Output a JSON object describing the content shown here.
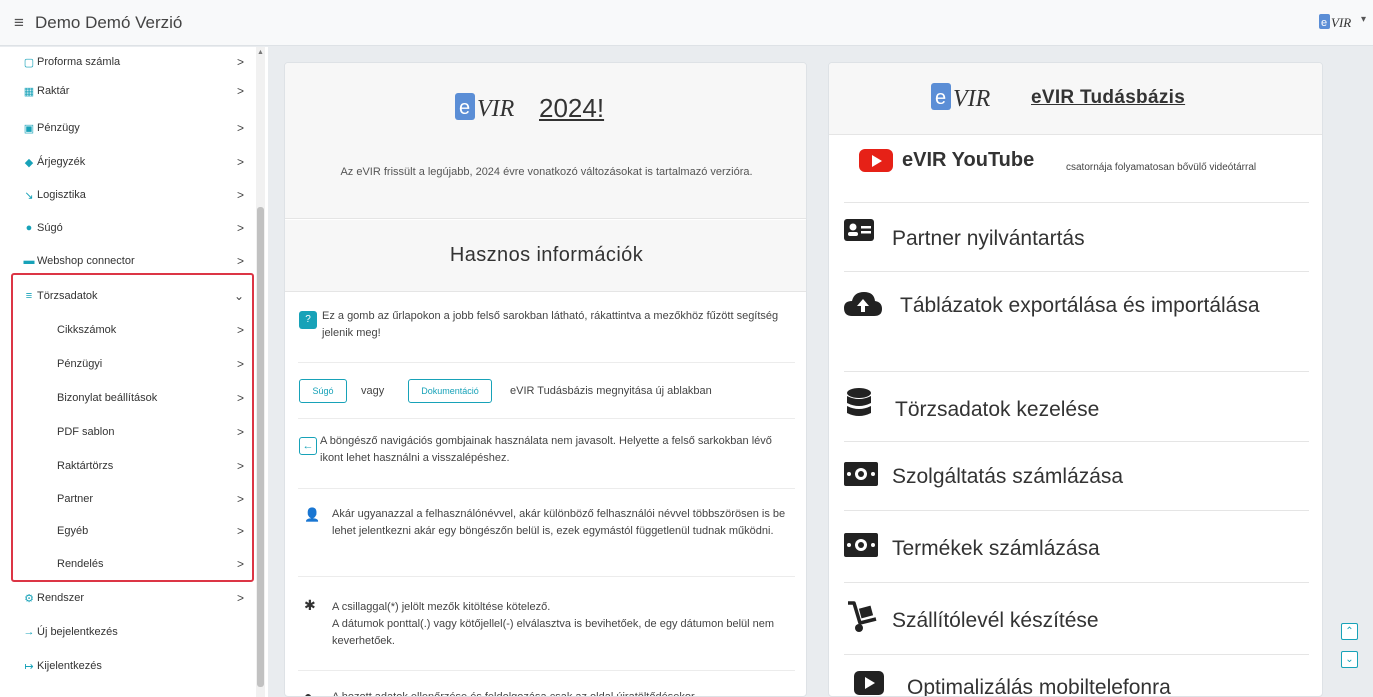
{
  "header": {
    "menu_icon": "hamburger-icon",
    "title": "Demo Demó Verzió",
    "user_caret": "▾"
  },
  "sidebar": {
    "items": [
      {
        "icon": "document-icon",
        "glyph": "▢",
        "label": "Proforma számla"
      },
      {
        "icon": "warehouse-icon",
        "glyph": "▦",
        "label": "Raktár"
      },
      {
        "icon": "money-icon",
        "glyph": "▣",
        "label": "Pénzügy"
      },
      {
        "icon": "tags-icon",
        "glyph": "◆",
        "label": "Árjegyzék"
      },
      {
        "icon": "dolly-icon",
        "glyph": "↘",
        "label": "Logisztika"
      },
      {
        "icon": "question-icon",
        "glyph": "●",
        "label": "Súgó"
      },
      {
        "icon": "cart-icon",
        "glyph": "▬",
        "label": "Webshop connector"
      },
      {
        "icon": "database-icon",
        "glyph": "≡",
        "label": "Törzsadatok"
      },
      {
        "label": "Cikkszámok"
      },
      {
        "label": "Pénzügyi"
      },
      {
        "label": "Bizonylat beállítások"
      },
      {
        "label": "PDF sablon"
      },
      {
        "label": "Raktártörzs"
      },
      {
        "label": "Partner"
      },
      {
        "label": "Egyéb"
      },
      {
        "label": "Rendelés"
      },
      {
        "icon": "cogs-icon",
        "glyph": "⚙",
        "label": "Rendszer"
      },
      {
        "icon": "login-icon",
        "glyph": "→",
        "label": "Új bejelentkezés"
      },
      {
        "icon": "logout-icon",
        "glyph": "↦",
        "label": "Kijelentkezés"
      }
    ],
    "arrow": ">",
    "open_arrow": "⌄"
  },
  "main": {
    "release": {
      "year_title": "2024!",
      "text": "Az eVIR frissült a legújabb, 2024 évre vonatkozó változásokat is tartalmazó verzióra."
    },
    "useful": {
      "title": "Hasznos információk",
      "help_badge": "?",
      "help_text": "Ez a gomb az űrlapokon a jobb felső sarokban látható, rákattintva a mezőkhöz fűzött segítség jelenik meg!",
      "sugo_label": "Súgó",
      "vagy": "vagy",
      "docs_label": "Dokumentáció",
      "kb_open_text": "eVIR Tudásbázis megnyitása új ablakban",
      "back_glyph": "←",
      "back_text": "A böngésző navigációs gombjainak használata nem javasolt. Helyette a felső sarkokban lévő ikont lehet használni a visszalépéshez.",
      "user_glyph": "👤",
      "user_text": "Akár ugyanazzal a felhasználónévvel, akár különböző felhasználói névvel többszörösen is be lehet jelentkezni akár egy böngészőn belül is, ezek egymástól függetlenül tudnak működni.",
      "asterisk": "✱",
      "required_text": "A csillaggal(*) jelölt mezők kitöltése kötelező.",
      "date_text": "A dátumok ponttal(.) vagy kötőjellel(-) elválasztva is bevihetőek, de egy dátumon belül nem keverhetőek.",
      "cut_text": "A hozott adatok ellenőrzése és feldolgozása csak az oldal újratöltődésekor"
    }
  },
  "knowledge": {
    "title": "eVIR Tudásbázis",
    "youtube_title": "eVIR YouTube",
    "youtube_desc": "csatornája folyamatosan bővülő videótárral",
    "items": [
      {
        "icon": "id-card-icon",
        "glyph": "🪪",
        "label": "Partner nyilvántartás"
      },
      {
        "icon": "cloud-upload-icon",
        "glyph": "☁",
        "label": "Táblázatok exportálása és importálása"
      },
      {
        "icon": "database-icon",
        "glyph": "⛁",
        "label": "Törzsadatok kezelése"
      },
      {
        "icon": "money-bill-icon",
        "glyph": "▣",
        "label": "Szolgáltatás számlázása"
      },
      {
        "icon": "money-bill-icon",
        "glyph": "▣",
        "label": "Termékek számlázása"
      },
      {
        "icon": "dolly-icon",
        "glyph": "⛟",
        "label": "Szállítólevél készítése"
      },
      {
        "icon": "youtube-play-icon",
        "glyph": "▶",
        "label": "Optimalizálás mobiltelefonra"
      }
    ]
  },
  "scroll": {
    "up": "⌃",
    "down": "⌄"
  },
  "colors": {
    "accent": "#17a2b8",
    "highlight": "#dc3545",
    "youtube": "#e62117",
    "logo_blue": "#5b8ed6"
  }
}
